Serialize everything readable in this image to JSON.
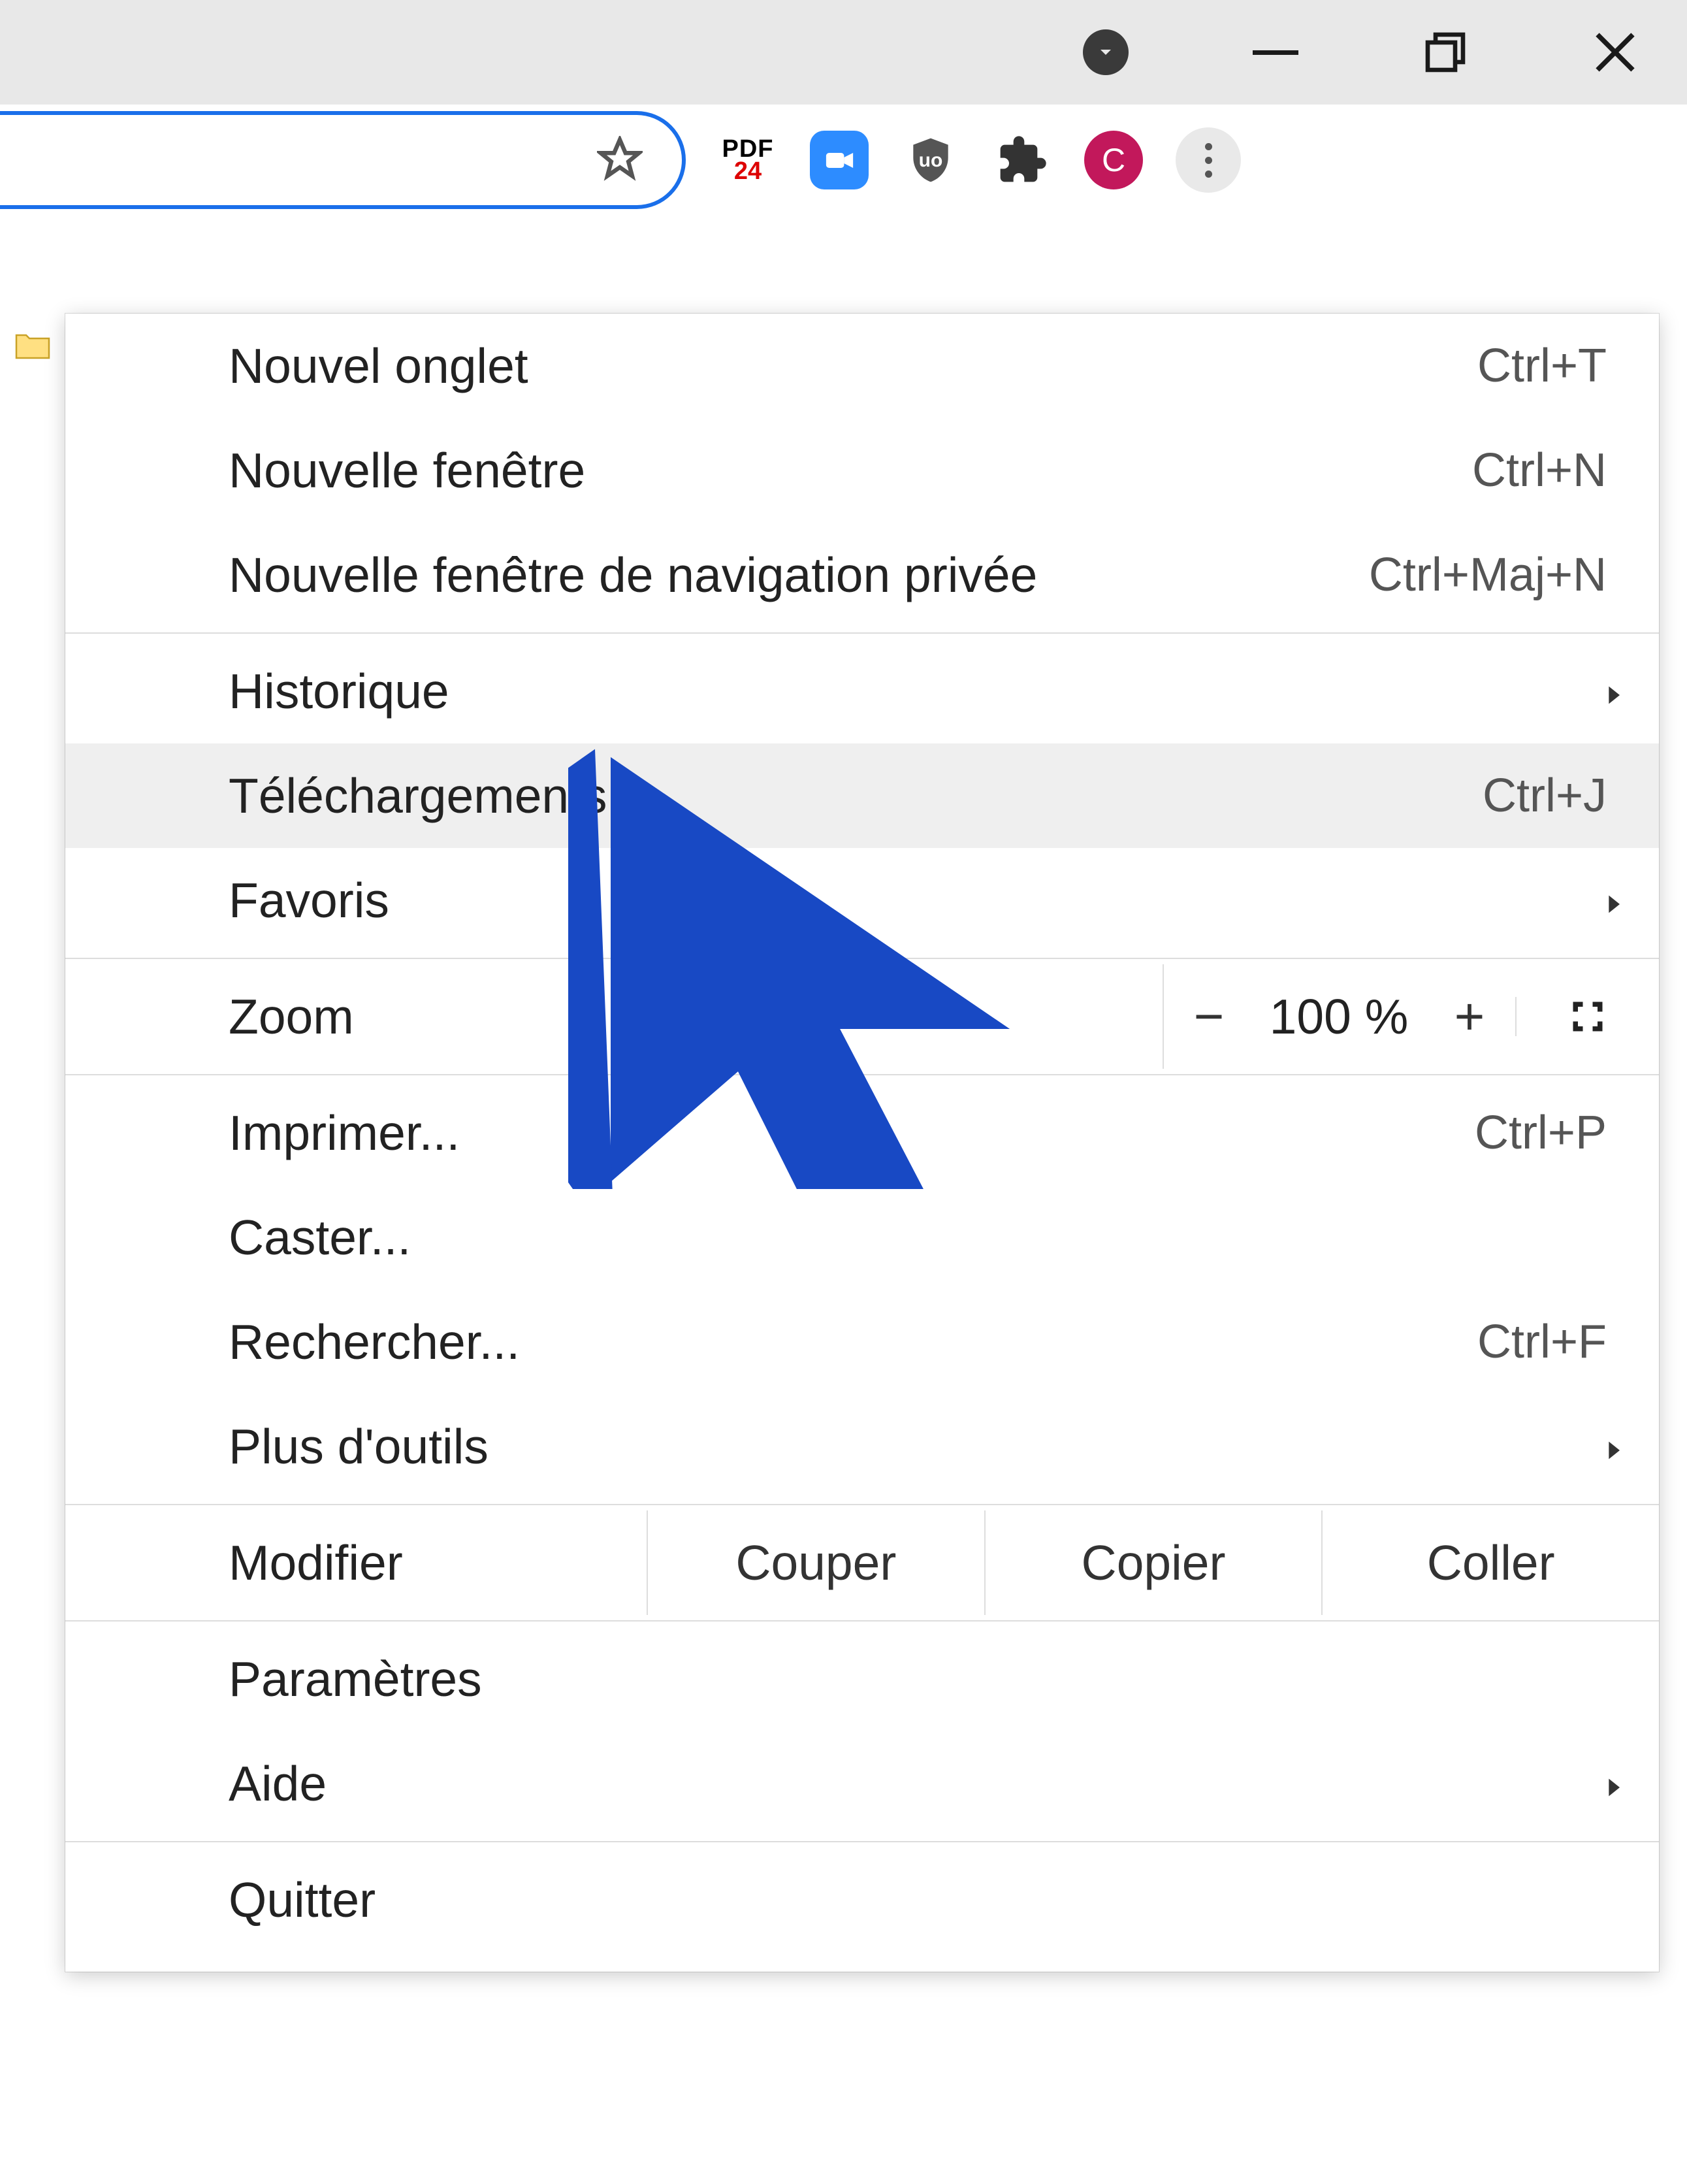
{
  "window_controls": {
    "downloads_indicator": "downloads",
    "minimize": "minimize",
    "maximize": "maximize",
    "close": "close"
  },
  "toolbar": {
    "star_tooltip": "Bookmark",
    "extensions": {
      "pdf24_top": "PDF",
      "pdf24_bottom": "24",
      "zoom": "Zoom",
      "ublock": "uBlock",
      "extensions_menu": "Extensions"
    },
    "profile_letter": "C",
    "kebab": "Customize and control"
  },
  "menu": {
    "new_tab": {
      "label": "Nouvel onglet",
      "shortcut": "Ctrl+T"
    },
    "new_window": {
      "label": "Nouvelle fenêtre",
      "shortcut": "Ctrl+N"
    },
    "incognito": {
      "label": "Nouvelle fenêtre de navigation privée",
      "shortcut": "Ctrl+Maj+N"
    },
    "history": {
      "label": "Historique"
    },
    "downloads": {
      "label": "Téléchargements",
      "shortcut": "Ctrl+J"
    },
    "bookmarks": {
      "label": "Favoris"
    },
    "zoom": {
      "label": "Zoom",
      "minus": "−",
      "value": "100 %",
      "plus": "+"
    },
    "print": {
      "label": "Imprimer...",
      "shortcut": "Ctrl+P"
    },
    "cast": {
      "label": "Caster..."
    },
    "find": {
      "label": "Rechercher...",
      "shortcut": "Ctrl+F"
    },
    "more_tools": {
      "label": "Plus d'outils"
    },
    "edit": {
      "label": "Modifier",
      "cut": "Couper",
      "copy": "Copier",
      "paste": "Coller"
    },
    "settings": {
      "label": "Paramètres"
    },
    "help": {
      "label": "Aide"
    },
    "quit": {
      "label": "Quitter"
    }
  },
  "cursor": {
    "color": "#1849c4"
  }
}
